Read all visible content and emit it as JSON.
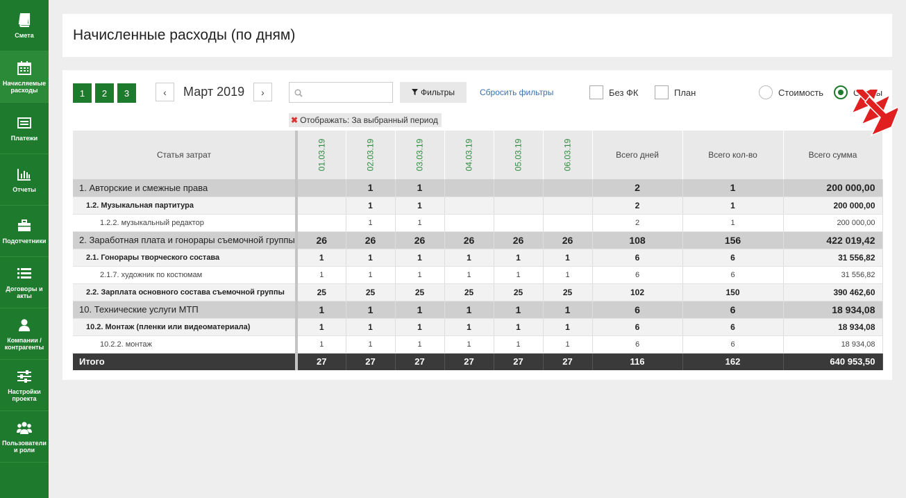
{
  "sidebar": {
    "items": [
      {
        "label": "Смета",
        "icon": "book-icon"
      },
      {
        "label": "Начисляемые расходы",
        "icon": "calendar-icon"
      },
      {
        "label": "Платежи",
        "icon": "card-icon"
      },
      {
        "label": "Отчеты",
        "icon": "bar-chart-icon"
      },
      {
        "label": "Подотчетники",
        "icon": "briefcase-icon"
      },
      {
        "label": "Договоры и акты",
        "icon": "list-icon"
      },
      {
        "label": "Компании / контрагенты",
        "icon": "user-icon"
      },
      {
        "label": "Настройки проекта",
        "icon": "sliders-icon"
      },
      {
        "label": "Пользователи и роли",
        "icon": "users-icon"
      }
    ]
  },
  "header": {
    "title": "Начисленные расходы (по дням)"
  },
  "toolbar": {
    "pages": [
      "1",
      "2",
      "3"
    ],
    "prev_label": "‹",
    "next_label": "›",
    "month": "Март 2019",
    "search_value": "",
    "filters_label": "Фильтры",
    "reset_label": "Сбросить фильтры",
    "chk_no_fk_label": "Без ФК",
    "chk_plan_label": "План",
    "radio_cost_label": "Стоимость",
    "radio_shifts_label": "Смены",
    "selected_mode": "Смены",
    "tag_label": "Отображать:  За выбранный период"
  },
  "table": {
    "headers": {
      "name": "Статья затрат",
      "dates": [
        "01.03.19",
        "02.03.19",
        "03.03.19",
        "04.03.19",
        "05.03.19",
        "06.03.19"
      ],
      "days": "Всего дней",
      "qty": "Всего кол-во",
      "sum": "Всего сумма"
    },
    "rows": [
      {
        "level": 1,
        "name": "1. Авторские и смежные права",
        "d": [
          "",
          "1",
          "1",
          "",
          "",
          ""
        ],
        "days": "2",
        "qty": "1",
        "sum": "200 000,00"
      },
      {
        "level": 2,
        "name": "1.2. Музыкальная партитура",
        "d": [
          "",
          "1",
          "1",
          "",
          "",
          ""
        ],
        "days": "2",
        "qty": "1",
        "sum": "200 000,00"
      },
      {
        "level": 3,
        "name": "1.2.2. музыкальный редактор",
        "d": [
          "",
          "1",
          "1",
          "",
          "",
          ""
        ],
        "days": "2",
        "qty": "1",
        "sum": "200 000,00"
      },
      {
        "level": 1,
        "name": "2. Заработная плата и гонорары съемочной группы",
        "d": [
          "26",
          "26",
          "26",
          "26",
          "26",
          "26"
        ],
        "days": "108",
        "qty": "156",
        "sum": "422 019,42"
      },
      {
        "level": 2,
        "name": "2.1. Гонорары творческого состава",
        "d": [
          "1",
          "1",
          "1",
          "1",
          "1",
          "1"
        ],
        "days": "6",
        "qty": "6",
        "sum": "31 556,82"
      },
      {
        "level": 3,
        "name": "2.1.7. художник по костюмам",
        "d": [
          "1",
          "1",
          "1",
          "1",
          "1",
          "1"
        ],
        "days": "6",
        "qty": "6",
        "sum": "31 556,82"
      },
      {
        "level": 2,
        "name": "2.2. Зарплата основного состава съемочной группы",
        "d": [
          "25",
          "25",
          "25",
          "25",
          "25",
          "25"
        ],
        "days": "102",
        "qty": "150",
        "sum": "390 462,60"
      },
      {
        "level": 1,
        "name": "10. Технические услуги МТП",
        "d": [
          "1",
          "1",
          "1",
          "1",
          "1",
          "1"
        ],
        "days": "6",
        "qty": "6",
        "sum": "18 934,08"
      },
      {
        "level": 2,
        "name": "10.2. Монтаж (пленки или видеоматериала)",
        "d": [
          "1",
          "1",
          "1",
          "1",
          "1",
          "1"
        ],
        "days": "6",
        "qty": "6",
        "sum": "18 934,08"
      },
      {
        "level": 3,
        "name": "10.2.2. монтаж",
        "d": [
          "1",
          "1",
          "1",
          "1",
          "1",
          "1"
        ],
        "days": "6",
        "qty": "6",
        "sum": "18 934,08"
      }
    ],
    "total": {
      "name": "Итого",
      "d": [
        "27",
        "27",
        "27",
        "27",
        "27",
        "27"
      ],
      "days": "116",
      "qty": "162",
      "sum": "640 953,50"
    }
  },
  "colors": {
    "accent": "#1e7a2c",
    "link": "#3a6fb0",
    "annotation_arrow": "#e02020"
  }
}
